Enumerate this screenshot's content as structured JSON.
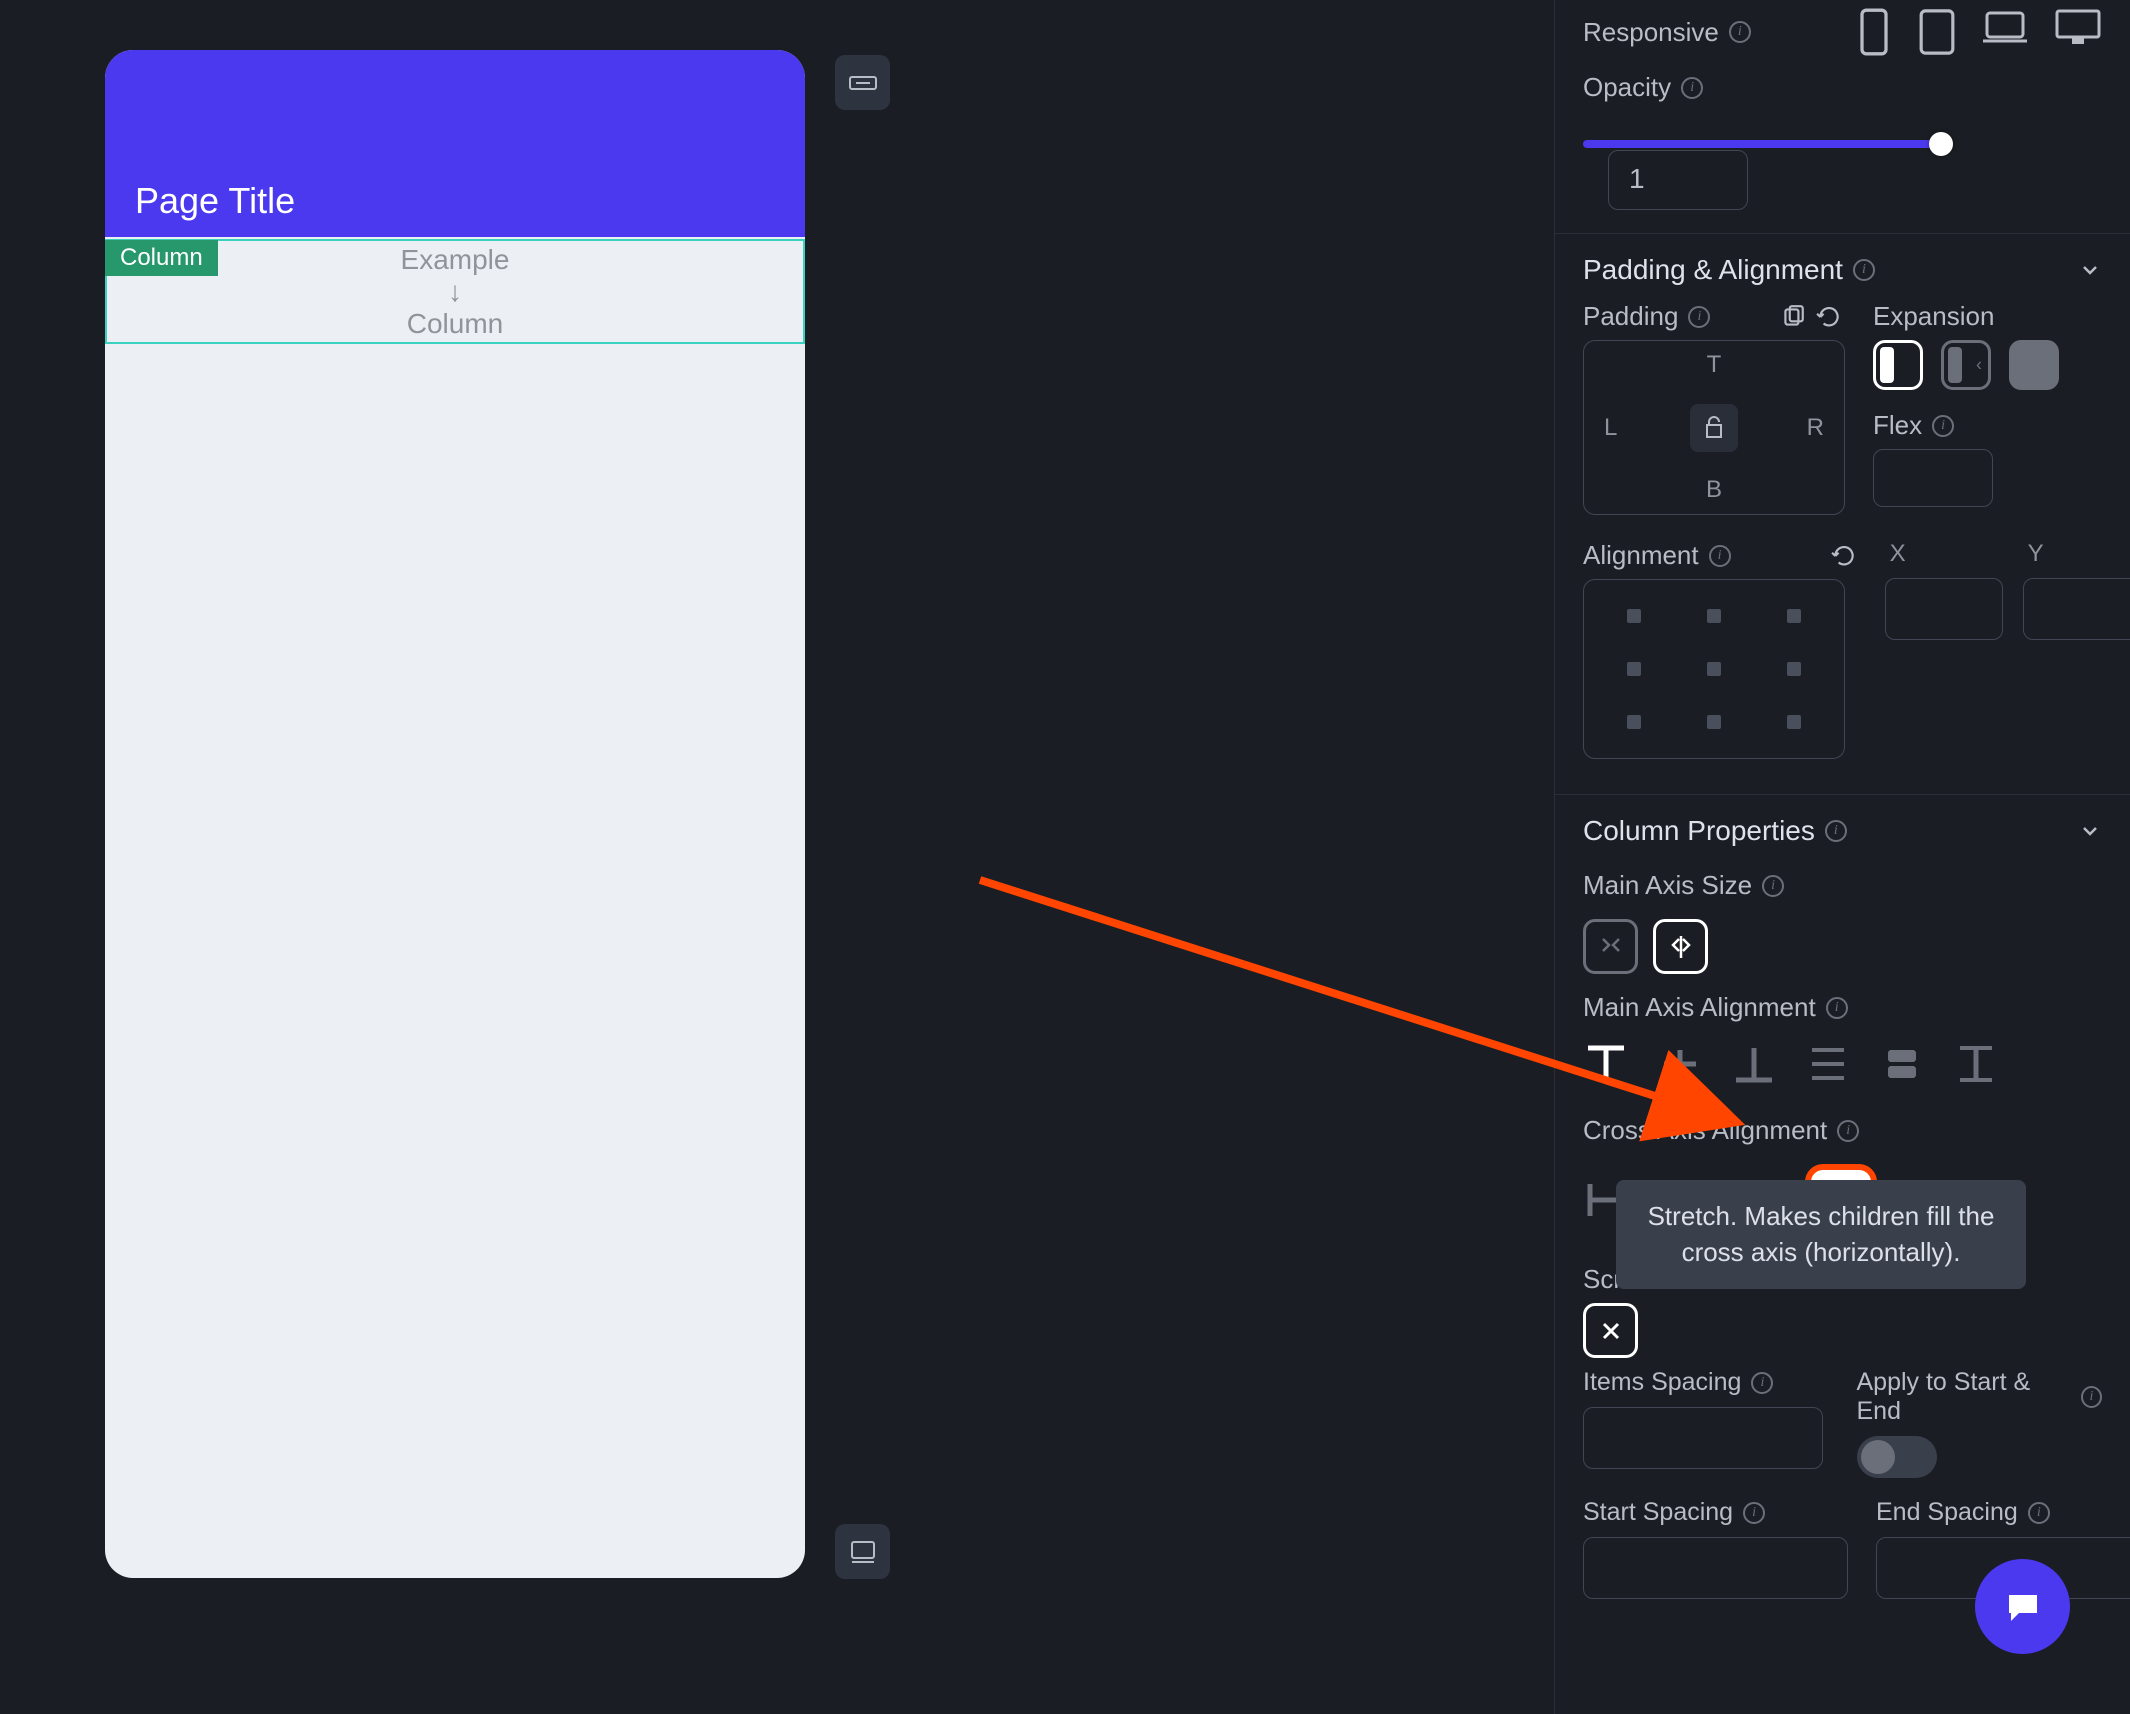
{
  "preview": {
    "title": "Page Title",
    "badge": "Column",
    "example_line1": "Example",
    "example_line2": "↓",
    "example_line3": "Column"
  },
  "props": {
    "responsive_label": "Responsive",
    "opacity_label": "Opacity",
    "opacity_value": "1",
    "padding_section": "Padding & Alignment",
    "padding_label": "Padding",
    "expansion_label": "Expansion",
    "flex_label": "Flex",
    "alignment_label": "Alignment",
    "pad_t": "T",
    "pad_l": "L",
    "pad_r": "R",
    "pad_b": "B",
    "x_label": "X",
    "y_label": "Y",
    "column_section": "Column Properties",
    "main_axis_size": "Main Axis Size",
    "main_axis_alignment": "Main Axis Alignment",
    "cross_axis_alignment": "Cross Axis Alignment",
    "scroll_label": "Scr",
    "items_spacing": "Items Spacing",
    "apply_start_end": "Apply to Start & End",
    "start_spacing": "Start Spacing",
    "end_spacing": "End Spacing"
  },
  "tooltip": "Stretch. Makes children fill the cross axis (horizontally)."
}
